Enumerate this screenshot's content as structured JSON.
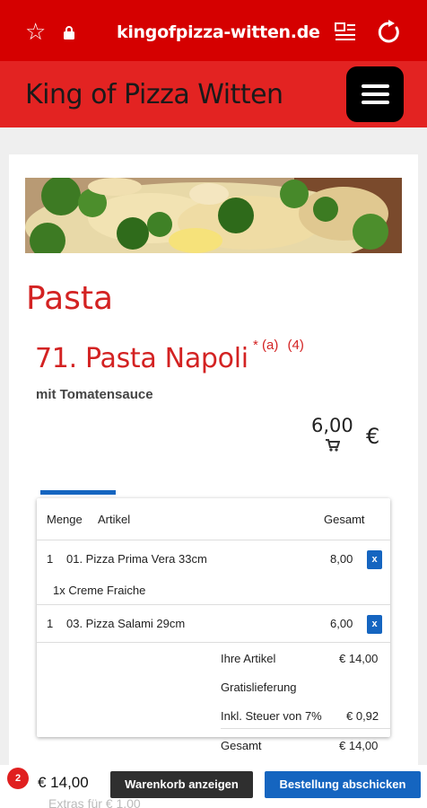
{
  "browser": {
    "url": "kingofpizza-witten.de",
    "icons": [
      "star-icon",
      "lock-icon",
      "reader-mode-icon",
      "reload-icon"
    ]
  },
  "site": {
    "title": "King of Pizza Witten",
    "menu_icon": "hamburger-menu-icon"
  },
  "category": {
    "title": "Pasta"
  },
  "dish": {
    "name": "71. Pasta Napoli",
    "asterisk": "*",
    "marker_a": "(a)",
    "marker_4": "(4)",
    "description": "mit Tomatensauce",
    "price": "6,00",
    "currency": "€",
    "cart_icon": "cart-icon"
  },
  "basket": {
    "headers": {
      "qty": "Menge",
      "article": "Artikel",
      "total": "Gesamt"
    },
    "items": [
      {
        "qty": "1",
        "name": "01. Pizza Prima Vera 33cm",
        "price": "8,00",
        "remove": "x",
        "extra": "1x Creme Fraiche"
      },
      {
        "qty": "1",
        "name": "03. Pizza Salami 29cm",
        "price": "6,00",
        "remove": "x"
      }
    ],
    "summary": {
      "items_label": "Ihre Artikel",
      "items_value": "€ 14,00",
      "delivery_label": "Gratislieferung",
      "tax_label": "Inkl. Steuer von 7%",
      "tax_value": "€ 0,92",
      "total_label": "Gesamt",
      "total_value": "€ 14,00"
    }
  },
  "bottom": {
    "badge_count": "2",
    "total": "€ 14,00",
    "show_cart": "Warenkorb anzeigen",
    "checkout": "Bestellung abschicken",
    "behind_text": "Extras für € 1,00"
  },
  "colors": {
    "browser_bar": "#d50000",
    "site_header": "#e32322",
    "accent_red": "#d32222",
    "button_blue": "#1565c0",
    "button_dark": "#2f2f2f"
  }
}
